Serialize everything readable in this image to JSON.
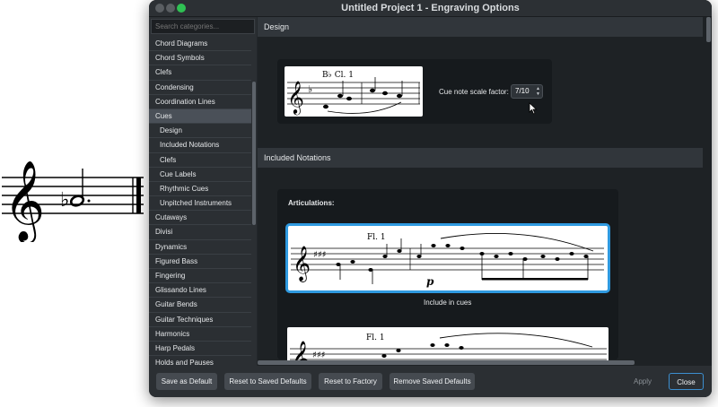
{
  "window": {
    "title": "Untitled Project 1 - Engraving Options"
  },
  "sidebar": {
    "search_placeholder": "Search categories...",
    "items": [
      {
        "label": "Chord Diagrams"
      },
      {
        "label": "Chord Symbols"
      },
      {
        "label": "Clefs"
      },
      {
        "label": "Condensing"
      },
      {
        "label": "Coordination Lines"
      },
      {
        "label": "Cues",
        "selected": true
      },
      {
        "label": "Design",
        "sub": true
      },
      {
        "label": "Included Notations",
        "sub": true
      },
      {
        "label": "Clefs",
        "sub": true
      },
      {
        "label": "Cue Labels",
        "sub": true
      },
      {
        "label": "Rhythmic Cues",
        "sub": true
      },
      {
        "label": "Unpitched Instruments",
        "sub": true
      },
      {
        "label": "Cutaways"
      },
      {
        "label": "Divisi"
      },
      {
        "label": "Dynamics"
      },
      {
        "label": "Figured Bass"
      },
      {
        "label": "Fingering"
      },
      {
        "label": "Glissando Lines"
      },
      {
        "label": "Guitar Bends"
      },
      {
        "label": "Guitar Techniques"
      },
      {
        "label": "Harmonics"
      },
      {
        "label": "Harp Pedals"
      },
      {
        "label": "Holds and Pauses"
      }
    ]
  },
  "design": {
    "heading": "Design",
    "example_label": "B♭ Cl. 1",
    "cue_scale_label": "Cue note scale factor:",
    "cue_scale_value": "7/10"
  },
  "included": {
    "heading": "Included Notations",
    "articulations_label": "Articulations:",
    "example_label": "Fl. 1",
    "dynamic_mark": "p",
    "include_caption": "Include in cues",
    "example2_label": "Fl. 1"
  },
  "footer": {
    "save_default": "Save as Default",
    "reset_saved": "Reset to Saved Defaults",
    "reset_factory": "Reset to Factory",
    "remove_saved": "Remove Saved Defaults",
    "apply": "Apply",
    "close": "Close"
  },
  "colors": {
    "accent": "#3c8fd0",
    "window_bg": "#23272b",
    "close_light": "#2fc153"
  },
  "icons": [
    "treble-clef-icon",
    "flat-icon",
    "pointer-cursor-icon",
    "spinner-up-icon",
    "spinner-down-icon"
  ]
}
